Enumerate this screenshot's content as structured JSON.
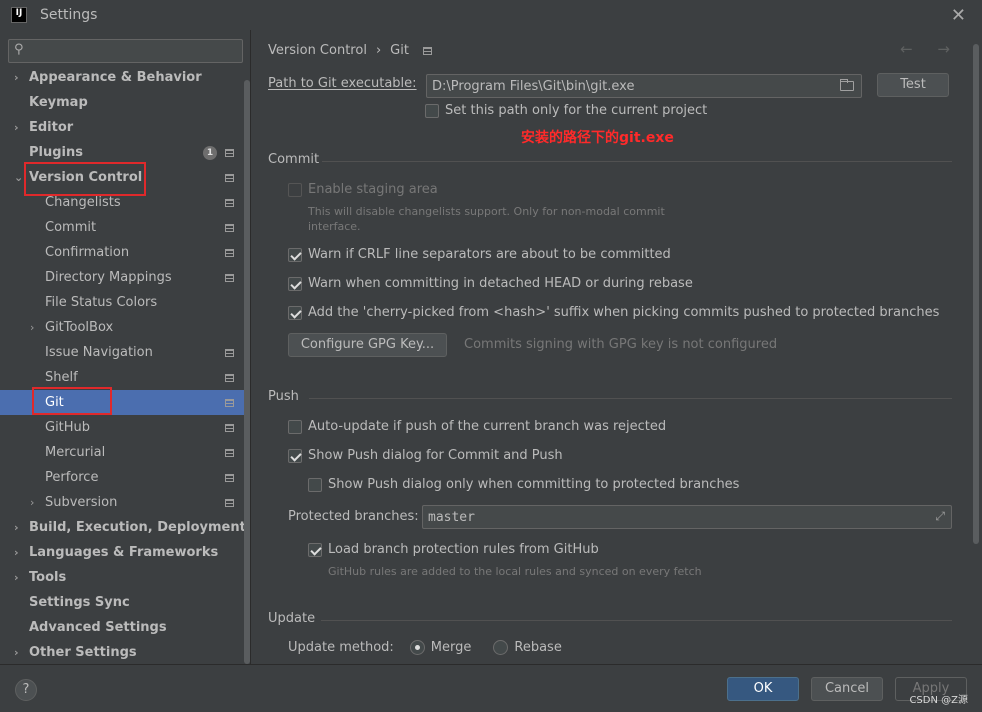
{
  "window": {
    "title": "Settings",
    "logo_text": "IJ"
  },
  "search": {
    "placeholder": ""
  },
  "sidebar": {
    "items": [
      {
        "label": "Appearance & Behavior",
        "arrow": "›",
        "level": 0,
        "bold": true
      },
      {
        "label": "Keymap",
        "arrow": "",
        "level": 0,
        "bold": true
      },
      {
        "label": "Editor",
        "arrow": "›",
        "level": 0,
        "bold": true
      },
      {
        "label": "Plugins",
        "arrow": "",
        "level": 0,
        "bold": true,
        "badge": "1",
        "icon": true
      },
      {
        "label": "Version Control",
        "arrow": "⌄",
        "level": 0,
        "bold": true,
        "icon": true
      },
      {
        "label": "Changelists",
        "level": 1,
        "icon": true
      },
      {
        "label": "Commit",
        "level": 1,
        "icon": true
      },
      {
        "label": "Confirmation",
        "level": 1,
        "icon": true
      },
      {
        "label": "Directory Mappings",
        "level": 1,
        "icon": true
      },
      {
        "label": "File Status Colors",
        "level": 1
      },
      {
        "label": "GitToolBox",
        "arrow": "›",
        "level": 1
      },
      {
        "label": "Issue Navigation",
        "level": 1,
        "icon": true
      },
      {
        "label": "Shelf",
        "level": 1,
        "icon": true
      },
      {
        "label": "Git",
        "level": 1,
        "icon": true,
        "selected": true
      },
      {
        "label": "GitHub",
        "level": 1,
        "icon": true
      },
      {
        "label": "Mercurial",
        "level": 1,
        "icon": true
      },
      {
        "label": "Perforce",
        "level": 1,
        "icon": true
      },
      {
        "label": "Subversion",
        "arrow": "›",
        "level": 1,
        "icon": true
      },
      {
        "label": "Build, Execution, Deployment",
        "arrow": "›",
        "level": 0,
        "bold": true
      },
      {
        "label": "Languages & Frameworks",
        "arrow": "›",
        "level": 0,
        "bold": true
      },
      {
        "label": "Tools",
        "arrow": "›",
        "level": 0,
        "bold": true
      },
      {
        "label": "Settings Sync",
        "arrow": "",
        "level": 0,
        "bold": true
      },
      {
        "label": "Advanced Settings",
        "arrow": "",
        "level": 0,
        "bold": true
      },
      {
        "label": "Other Settings",
        "arrow": "›",
        "level": 0,
        "bold": true
      }
    ]
  },
  "breadcrumb": {
    "parent": "Version Control",
    "separator": "›",
    "current": "Git",
    "nav": "← →"
  },
  "git": {
    "path_label": "Path to Git executable:",
    "path_value": "D:\\Program Files\\Git\\bin\\git.exe",
    "test_button": "Test",
    "set_path_only": "Set this path only for the current project",
    "annotation": "安装的路径下的git.exe"
  },
  "commit": {
    "title": "Commit",
    "enable_staging": "Enable staging area",
    "staging_hint_line1": "This will disable changelists support. Only for non-modal commit",
    "staging_hint_line2": "interface.",
    "warn_crlf": "Warn if CRLF line separators are about to be committed",
    "warn_detached": "Warn when committing in detached HEAD or during rebase",
    "cherry_picked": "Add the 'cherry-picked from <hash>' suffix when picking commits pushed to protected branches",
    "gpg_button": "Configure GPG Key...",
    "gpg_status": "Commits signing with GPG key is not configured"
  },
  "push": {
    "title": "Push",
    "auto_update": "Auto-update if push of the current branch was rejected",
    "show_push_dialog": "Show Push dialog for Commit and Push",
    "show_push_protected": "Show Push dialog only when committing to protected branches",
    "protected_label": "Protected branches:",
    "protected_value": "master",
    "load_rules": "Load branch protection rules from GitHub",
    "rules_hint": "GitHub rules are added to the local rules and synced on every fetch"
  },
  "update": {
    "title": "Update",
    "method_label": "Update method:",
    "merge": "Merge",
    "rebase": "Rebase"
  },
  "footer": {
    "help": "?",
    "ok": "OK",
    "cancel": "Cancel",
    "apply": "Apply",
    "watermark": "CSDN @Z源"
  },
  "colors": {
    "selection": "#4b6eaf",
    "highlight_box": "#e0292b",
    "annotation": "#ff2a2a"
  }
}
